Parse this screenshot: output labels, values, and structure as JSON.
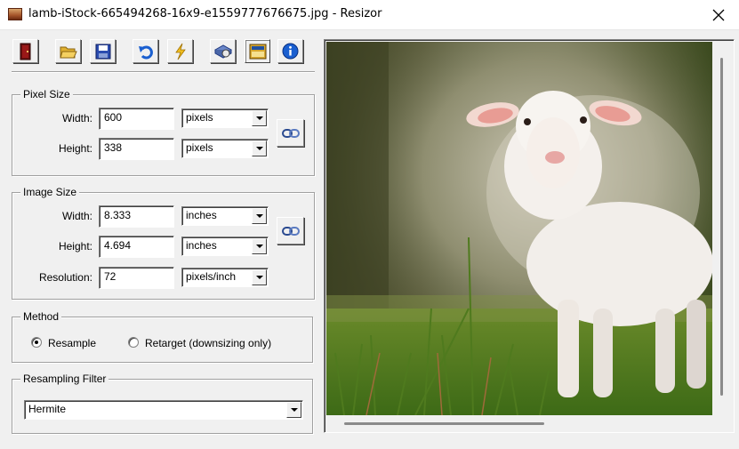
{
  "window": {
    "title": "lamb-iStock-665494268-16x9-e1559777676675.jpg - Resizor"
  },
  "toolbar": {
    "buttons": [
      {
        "icon": "exit-door-icon"
      },
      {
        "icon": "open-folder-icon"
      },
      {
        "icon": "save-disk-icon"
      },
      {
        "icon": "undo-icon"
      },
      {
        "icon": "lightning-icon"
      },
      {
        "icon": "settings-icon"
      },
      {
        "icon": "batch-window-icon"
      },
      {
        "icon": "info-icon"
      }
    ]
  },
  "pixel_size": {
    "title": "Pixel Size",
    "width_label": "Width:",
    "width_value": "600",
    "width_unit": "pixels",
    "height_label": "Height:",
    "height_value": "338",
    "height_unit": "pixels",
    "link_icon": "chain-link-icon"
  },
  "image_size": {
    "title": "Image Size",
    "width_label": "Width:",
    "width_value": "8.333",
    "width_unit": "inches",
    "height_label": "Height:",
    "height_value": "4.694",
    "height_unit": "inches",
    "resolution_label": "Resolution:",
    "resolution_value": "72",
    "resolution_unit": "pixels/inch",
    "link_icon": "chain-link-icon"
  },
  "method": {
    "title": "Method",
    "options": [
      {
        "label": "Resample",
        "selected": true
      },
      {
        "label": "Retarget (downsizing only)",
        "selected": false
      }
    ]
  },
  "resampling_filter": {
    "title": "Resampling Filter",
    "value": "Hermite"
  },
  "preview": {
    "image": "photo of a white lamb standing in green grass"
  },
  "colors": {
    "window_bg": "#f0f0f0",
    "info_blue": "#1a5fd0"
  }
}
